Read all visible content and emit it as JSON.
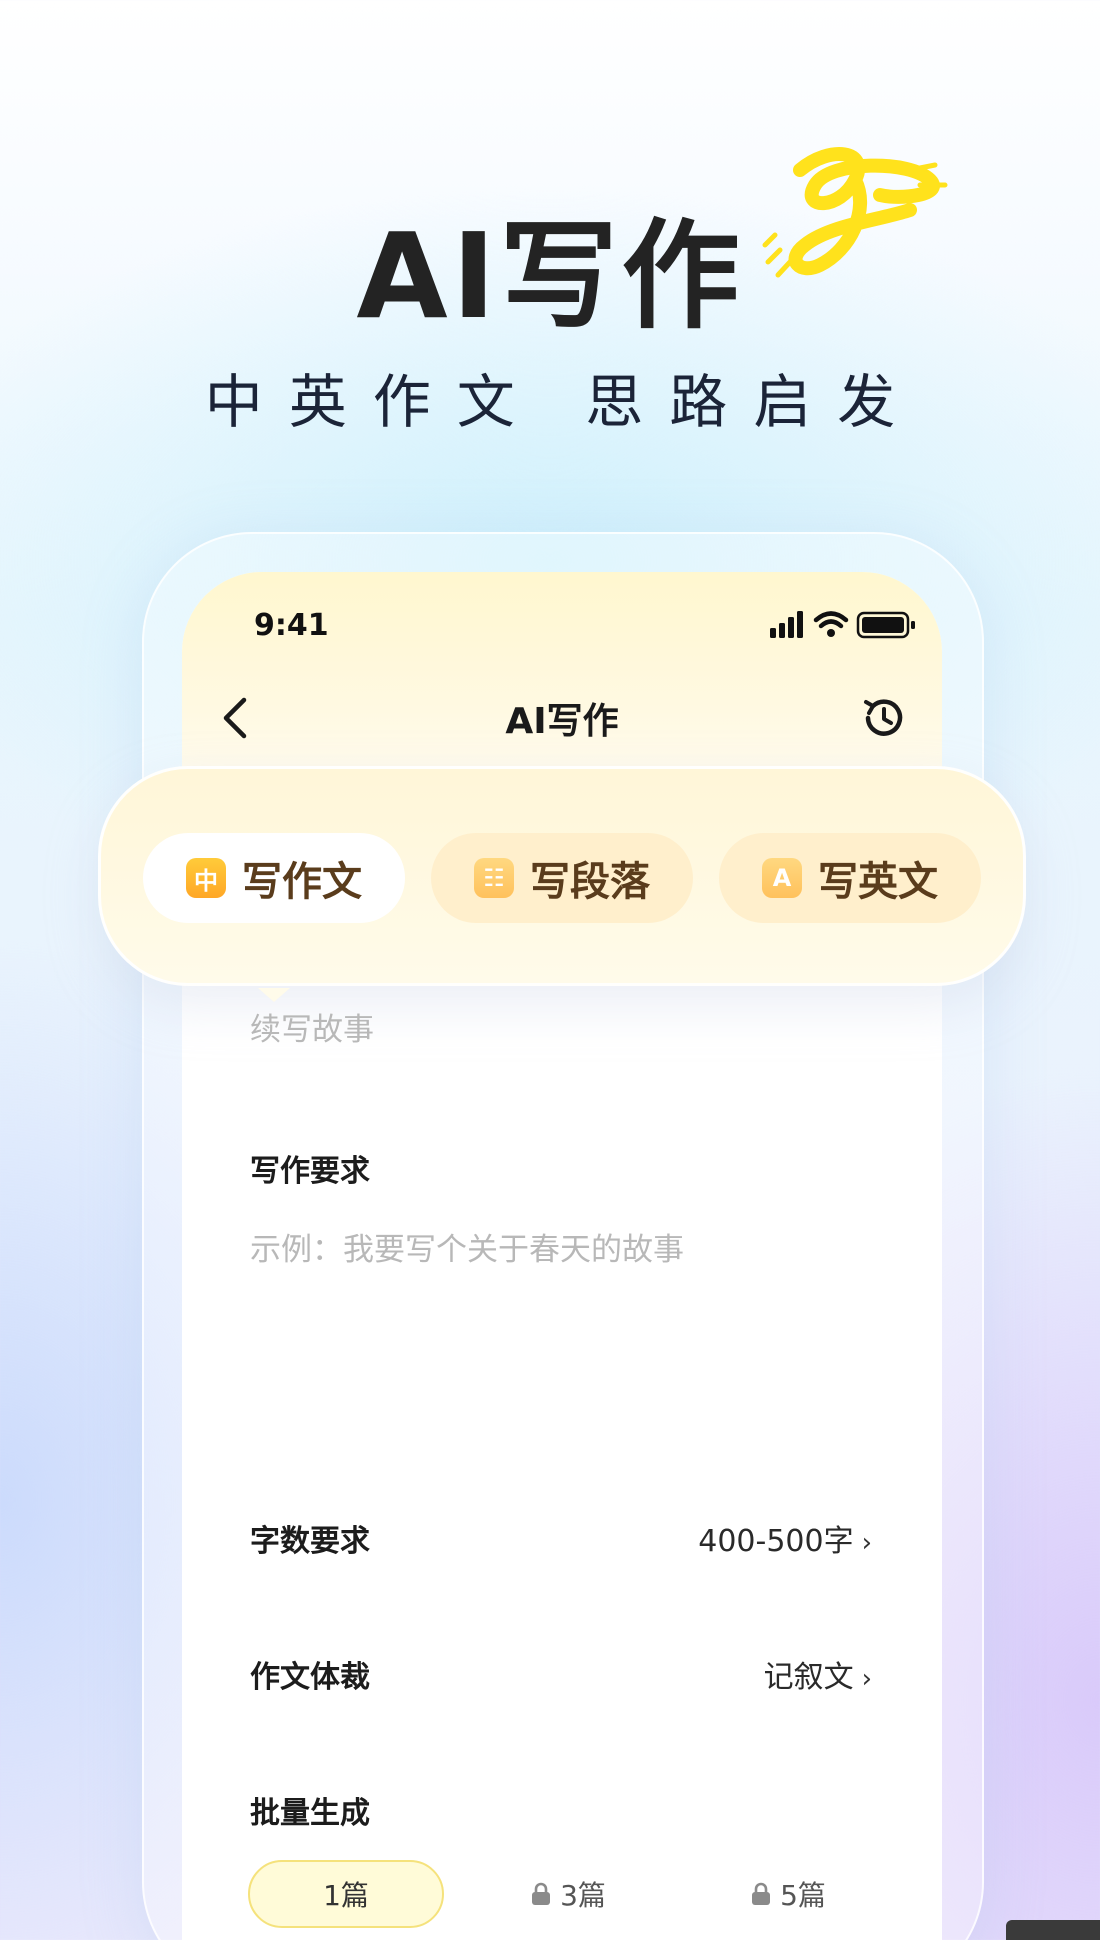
{
  "hero": {
    "title": "AI写作",
    "subtitle": "中英作文 思路启发"
  },
  "status_bar": {
    "time": "9:41"
  },
  "nav": {
    "title": "AI写作",
    "icons": [
      "back-icon",
      "history-icon"
    ]
  },
  "tabs": [
    {
      "icon_text": "中",
      "label": "写作文",
      "active": true
    },
    {
      "icon_text": "☷",
      "label": "写段落",
      "active": false
    },
    {
      "icon_text": "A",
      "label": "写英文",
      "active": false
    }
  ],
  "form": {
    "topic_placeholder": "续写故事",
    "requirement_label": "写作要求",
    "requirement_placeholder": "示例：我要写个关于春天的故事",
    "word_count_label": "字数要求",
    "word_count_value": "400-500字",
    "genre_label": "作文体裁",
    "genre_value": "记叙文",
    "batch_label": "批量生成",
    "batch_options": [
      {
        "label": "1篇",
        "locked": false,
        "selected": true
      },
      {
        "label": "3篇",
        "locked": true,
        "selected": false
      },
      {
        "label": "5篇",
        "locked": true,
        "selected": false
      }
    ]
  },
  "colors": {
    "accent_yellow": "#ffe24a",
    "tab_text": "#5a3c1c",
    "placeholder": "#b8b8b8"
  }
}
